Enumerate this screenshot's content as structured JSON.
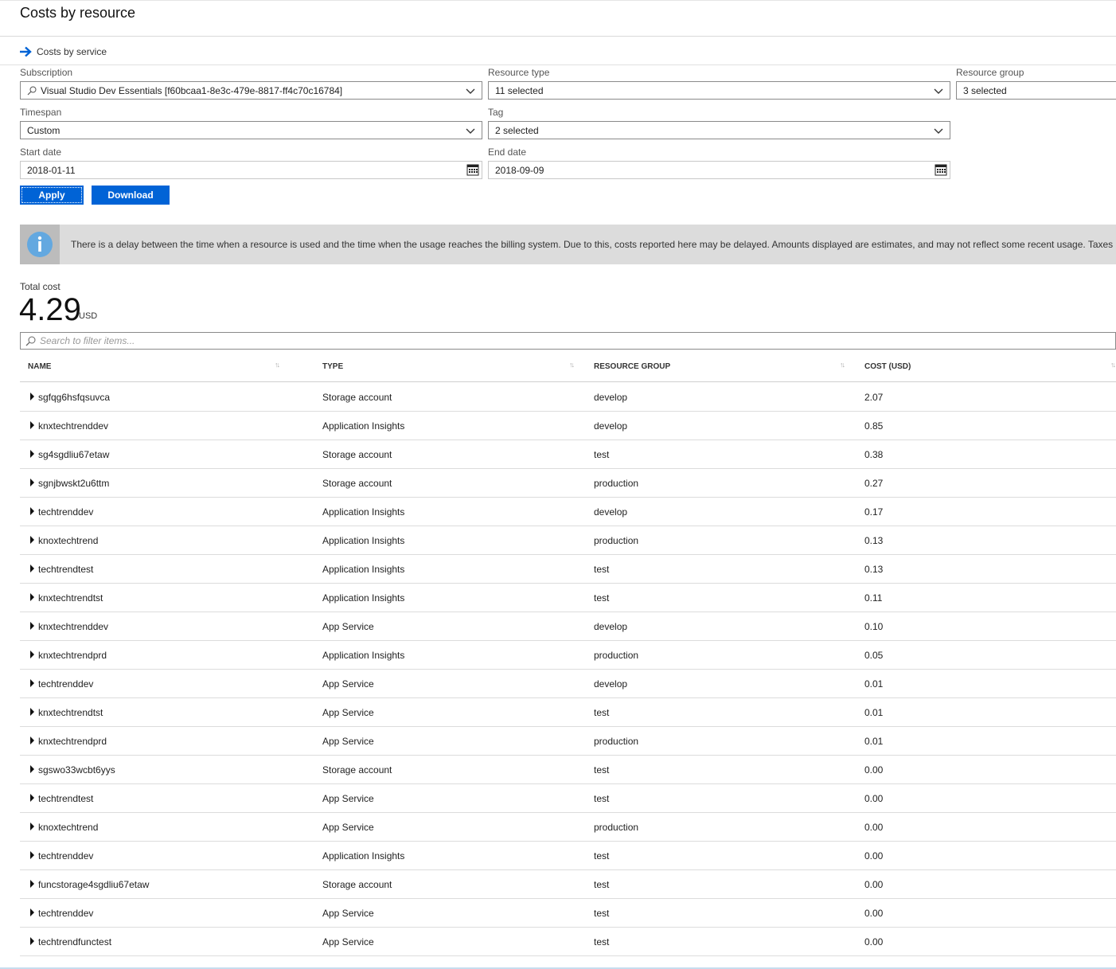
{
  "page": {
    "title": "Costs by resource"
  },
  "nav": {
    "link_label": "Costs by service"
  },
  "filters": {
    "subscription": {
      "label": "Subscription",
      "value": "Visual Studio Dev Essentials [f60bcaa1-8e3c-479e-8817-ff4c70c16784]"
    },
    "resource_type": {
      "label": "Resource type",
      "value": "11 selected"
    },
    "resource_group": {
      "label": "Resource group",
      "value": "3 selected"
    },
    "timespan": {
      "label": "Timespan",
      "value": "Custom"
    },
    "tag": {
      "label": "Tag",
      "value": "2 selected"
    },
    "start_date": {
      "label": "Start date",
      "value": "2018-01-11"
    },
    "end_date": {
      "label": "End date",
      "value": "2018-09-09"
    }
  },
  "actions": {
    "apply_label": "Apply",
    "download_label": "Download"
  },
  "info": {
    "message": "There is a delay between the time when a resource is used and the time when the usage reaches the billing system. Due to this, costs reported here may be delayed. Amounts displayed are estimates, and may not reflect some recent usage. Taxes are"
  },
  "total": {
    "label": "Total cost",
    "value": "4.29",
    "unit": "USD"
  },
  "search": {
    "placeholder": "Search to filter items..."
  },
  "table": {
    "columns": {
      "name": "NAME",
      "type": "TYPE",
      "resource_group": "RESOURCE GROUP",
      "cost": "COST (USD)"
    },
    "rows": [
      {
        "name": "sgfqg6hsfqsuvca",
        "type": "Storage account",
        "group": "develop",
        "cost": "2.07"
      },
      {
        "name": "knxtechtrenddev",
        "type": "Application Insights",
        "group": "develop",
        "cost": "0.85"
      },
      {
        "name": "sg4sgdliu67etaw",
        "type": "Storage account",
        "group": "test",
        "cost": "0.38"
      },
      {
        "name": "sgnjbwskt2u6ttm",
        "type": "Storage account",
        "group": "production",
        "cost": "0.27"
      },
      {
        "name": "techtrenddev",
        "type": "Application Insights",
        "group": "develop",
        "cost": "0.17"
      },
      {
        "name": "knoxtechtrend",
        "type": "Application Insights",
        "group": "production",
        "cost": "0.13"
      },
      {
        "name": "techtrendtest",
        "type": "Application Insights",
        "group": "test",
        "cost": "0.13"
      },
      {
        "name": "knxtechtrendtst",
        "type": "Application Insights",
        "group": "test",
        "cost": "0.11"
      },
      {
        "name": "knxtechtrenddev",
        "type": "App Service",
        "group": "develop",
        "cost": "0.10"
      },
      {
        "name": "knxtechtrendprd",
        "type": "Application Insights",
        "group": "production",
        "cost": "0.05"
      },
      {
        "name": "techtrenddev",
        "type": "App Service",
        "group": "develop",
        "cost": "0.01"
      },
      {
        "name": "knxtechtrendtst",
        "type": "App Service",
        "group": "test",
        "cost": "0.01"
      },
      {
        "name": "knxtechtrendprd",
        "type": "App Service",
        "group": "production",
        "cost": "0.01"
      },
      {
        "name": "sgswo33wcbt6yys",
        "type": "Storage account",
        "group": "test",
        "cost": "0.00"
      },
      {
        "name": "techtrendtest",
        "type": "App Service",
        "group": "test",
        "cost": "0.00"
      },
      {
        "name": "knoxtechtrend",
        "type": "App Service",
        "group": "production",
        "cost": "0.00"
      },
      {
        "name": "techtrenddev",
        "type": "Application Insights",
        "group": "test",
        "cost": "0.00"
      },
      {
        "name": "funcstorage4sgdliu67etaw",
        "type": "Storage account",
        "group": "test",
        "cost": "0.00"
      },
      {
        "name": "techtrenddev",
        "type": "App Service",
        "group": "test",
        "cost": "0.00"
      },
      {
        "name": "techtrendfunctest",
        "type": "App Service",
        "group": "test",
        "cost": "0.00"
      }
    ]
  },
  "colors": {
    "accent": "#0063d6",
    "banner_bg": "#dcdcdc",
    "info_icon": "#63a8e0"
  },
  "icons": {
    "nav": "arrow-right-icon",
    "info": "info-icon",
    "search": "search-icon",
    "dropdown": "chevron-down-icon",
    "calendar": "calendar-icon",
    "expand": "caret-right-icon",
    "sort": "sort-icon"
  }
}
